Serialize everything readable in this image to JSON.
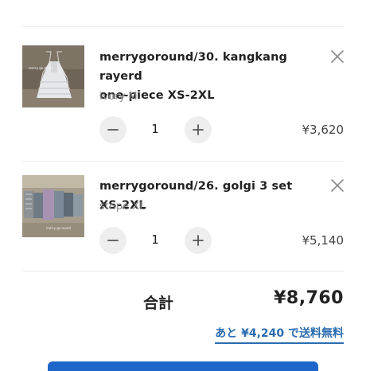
{
  "cart": {
    "items": [
      {
        "title_line1": "merrygoround/30. kangkang rayerd",
        "title_line2": "one-piece XS-2XL",
        "variant": "ivory M",
        "quantity": "1",
        "price": "¥3,620",
        "image_text": "merry go round"
      },
      {
        "title_line1": "merrygoround/26. golgi 3 set XS-2XL",
        "title_line2": "",
        "variant": "stripe XL",
        "quantity": "1",
        "price": "¥5,140",
        "image_text": "merry go round"
      }
    ],
    "icons": {
      "remove": "close-icon",
      "decrease": "minus-icon",
      "increase": "plus-icon"
    }
  },
  "summary": {
    "total_label": "合計",
    "total_value": "¥8,760",
    "free_shipping_text": "あと ¥4,240 で送料無料"
  },
  "colors": {
    "accent": "#2b6cb0",
    "checkout_button": "#1e66c9",
    "qty_button_bg": "#eeeeee"
  }
}
